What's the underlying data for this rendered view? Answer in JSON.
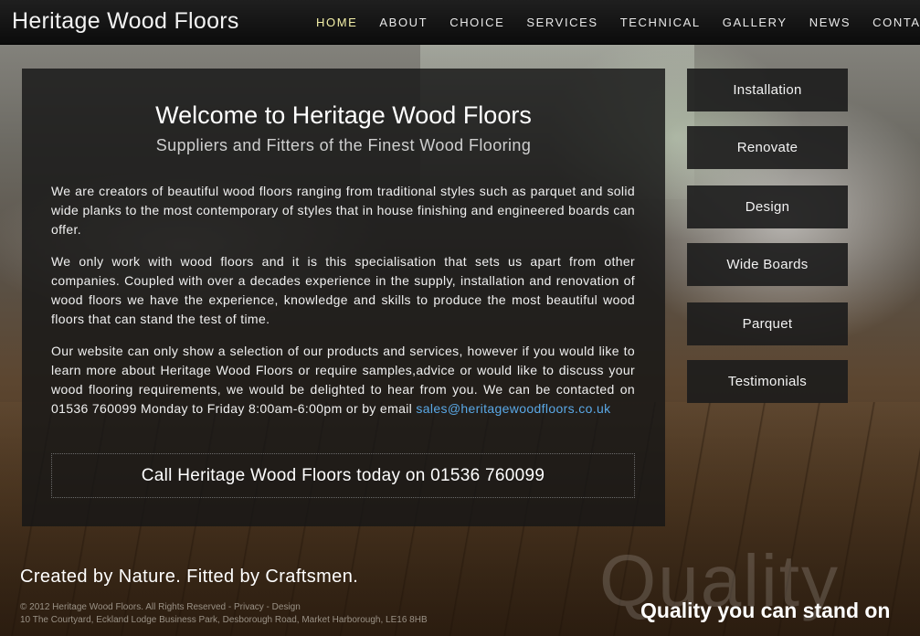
{
  "site": {
    "logo": "Heritage Wood Floors"
  },
  "nav": {
    "items": [
      "HOME",
      "ABOUT",
      "CHOICE",
      "SERVICES",
      "TECHNICAL",
      "GALLERY",
      "NEWS",
      "CONTACT"
    ],
    "active": "HOME",
    "active_color": "#f4f0a8"
  },
  "main": {
    "title": "Welcome to Heritage Wood Floors",
    "subtitle": "Suppliers and Fitters of the Finest Wood Flooring",
    "paragraphs": [
      "We are creators of beautiful wood floors ranging from traditional styles such as parquet and solid wide planks to the most contemporary of styles that in house finishing and engineered boards can offer.",
      "We only work with wood floors and it is this specialisation that sets us apart from other companies. Coupled with over a decades experience in the supply, installation and renovation of wood floors we have the experience, knowledge and skills to produce the most beautiful wood floors that can stand the test of time.",
      "Our website can only show a selection of our products and services, however if you would like to learn more about Heritage Wood Floors or require samples,advice or would like to discuss your wood flooring requirements, we would be delighted to hear from you. We can be contacted on 01536 760099 Monday to Friday 8:00am-6:00pm or by email"
    ],
    "email": "sales@heritagewoodfloors.co.uk",
    "link_color": "#5aa8e6",
    "call_to_action": "Call Heritage Wood Floors today on 01536 760099"
  },
  "sidebar": {
    "buttons": [
      "Installation",
      "Renovate",
      "Design",
      "Wide Boards",
      "Parquet",
      "Testimonials"
    ]
  },
  "footer": {
    "tagline": "Created by Nature. Fitted by Craftsmen.",
    "copyright": "© 2012 Heritage Wood Floors. All Rights Reserved",
    "privacy_link": "Privacy",
    "design_link": "Design",
    "address": "10 The Courtyard, Eckland Lodge Business Park, Desborough Road, Market Harborough, LE16 8HB",
    "watermark": "Quality",
    "slogan": "Quality you can stand on"
  }
}
